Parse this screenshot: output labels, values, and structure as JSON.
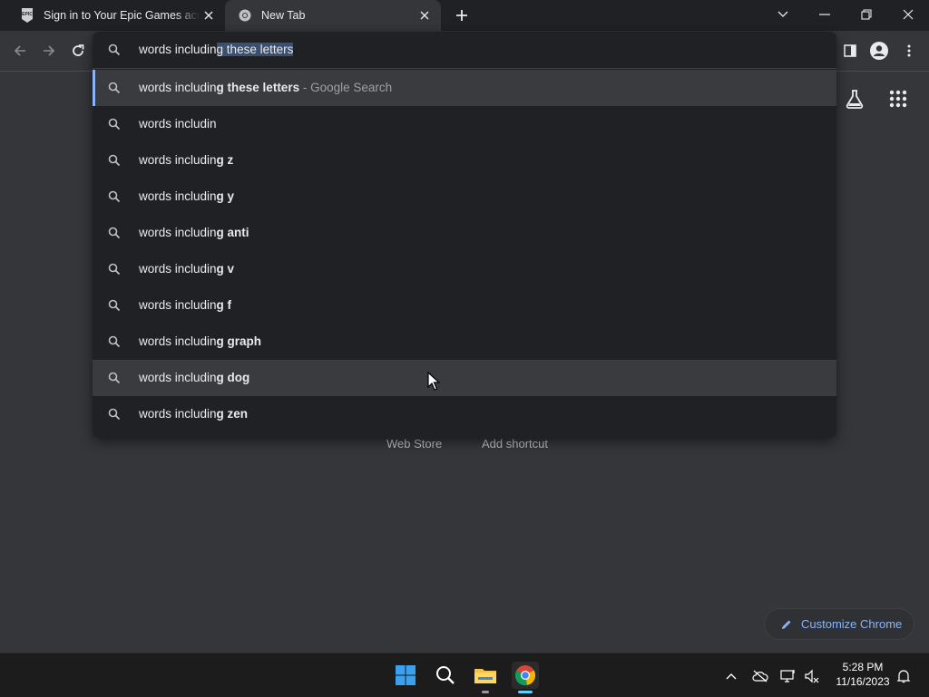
{
  "tabs": [
    {
      "title": "Sign in to Your Epic Games account",
      "favicon": "epic-games-icon",
      "active": false
    },
    {
      "title": "New Tab",
      "favicon": "chrome-icon",
      "active": true
    }
  ],
  "window_controls": [
    "chevron-down-icon",
    "minimize-icon",
    "restore-icon",
    "close-icon"
  ],
  "toolbar": {
    "back": "arrow-left-icon",
    "forward": "arrow-right-icon",
    "reload": "reload-icon",
    "side_panel": "side-panel-icon",
    "profile": "profile-icon",
    "menu": "kebab-menu-icon"
  },
  "omnibox": {
    "typed_prefix": "words includin",
    "typed_selected": "g these letters",
    "suggestions": [
      {
        "prefix": "words includin",
        "bold": "g these letters",
        "suffix": " - Google Search"
      },
      {
        "prefix": "words includin",
        "bold": "",
        "suffix": ""
      },
      {
        "prefix": "words includin",
        "bold": "g z",
        "suffix": ""
      },
      {
        "prefix": "words includin",
        "bold": "g y",
        "suffix": ""
      },
      {
        "prefix": "words includin",
        "bold": "g anti",
        "suffix": ""
      },
      {
        "prefix": "words includin",
        "bold": "g v",
        "suffix": ""
      },
      {
        "prefix": "words includin",
        "bold": "g f",
        "suffix": ""
      },
      {
        "prefix": "words includin",
        "bold": "g graph",
        "suffix": ""
      },
      {
        "prefix": "words includin",
        "bold": "g dog",
        "suffix": ""
      },
      {
        "prefix": "words includin",
        "bold": "g zen",
        "suffix": ""
      }
    ],
    "selected_index": 0,
    "hovered_index": 8
  },
  "ntp": {
    "shortcut_labels": [
      "Web Store",
      "Add shortcut"
    ],
    "customize_label": "Customize Chrome"
  },
  "taskbar": {
    "apps": [
      "windows-start-icon",
      "search-icon",
      "file-explorer-icon",
      "chrome-icon"
    ],
    "tray": [
      "chevron-up-icon",
      "onedrive-icon",
      "network-icon",
      "volume-muted-icon"
    ],
    "time": "5:28 PM",
    "date": "11/16/2023",
    "notification": "bell-icon"
  },
  "colors": {
    "accent": "#8ab4f8",
    "frame": "#202124",
    "page": "#35363a",
    "selection": "#3b4f6e"
  }
}
